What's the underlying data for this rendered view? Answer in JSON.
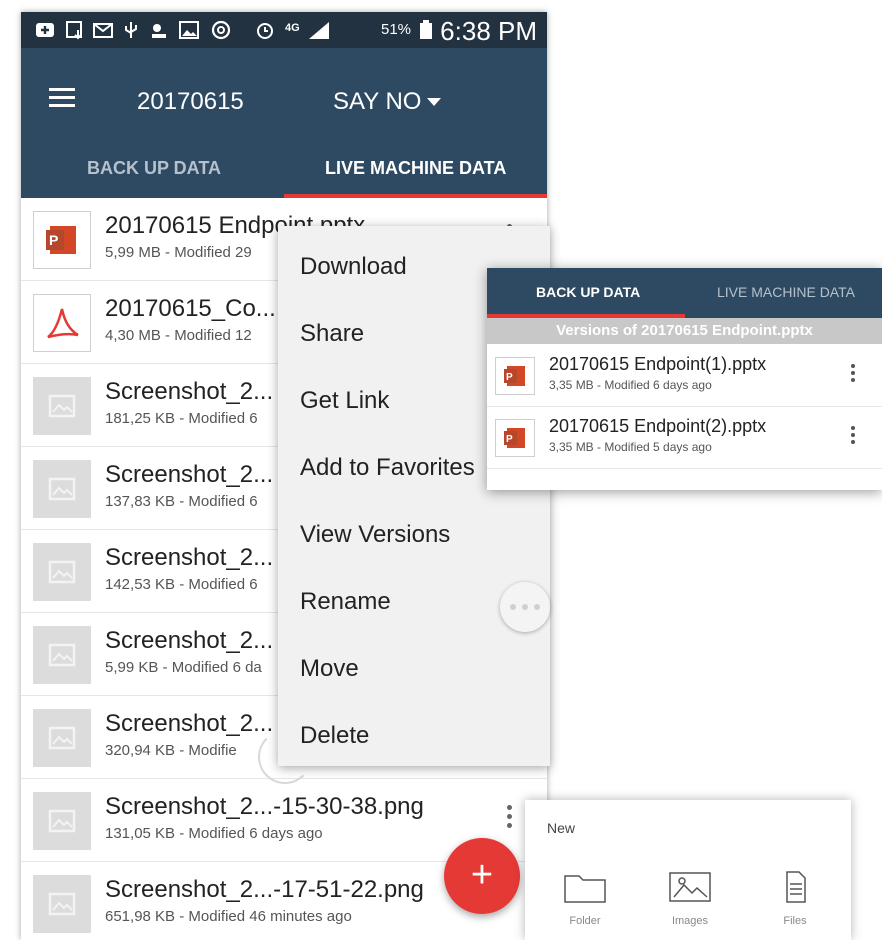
{
  "status_bar": {
    "battery": "51%",
    "time": "6:38 PM",
    "network": "4G"
  },
  "app_bar": {
    "title": "20170615",
    "dropdown": "SAY NO"
  },
  "tabs": [
    {
      "label": "BACK UP DATA"
    },
    {
      "label": "LIVE MACHINE DATA"
    }
  ],
  "files": [
    {
      "name": "20170615 Endpoint.pptx",
      "meta": "5,99 MB - Modified 29",
      "type": "pptx"
    },
    {
      "name": "20170615_Co...",
      "meta": "4,30 MB - Modified 12",
      "type": "pdf"
    },
    {
      "name": "Screenshot_2...",
      "meta": "181,25 KB - Modified 6",
      "type": "image"
    },
    {
      "name": "Screenshot_2...",
      "meta": "137,83 KB - Modified 6",
      "type": "image"
    },
    {
      "name": "Screenshot_2...",
      "meta": "142,53 KB - Modified 6",
      "type": "image"
    },
    {
      "name": "Screenshot_2...",
      "meta": "5,99 KB - Modified 6 da",
      "type": "image"
    },
    {
      "name": "Screenshot_2...",
      "meta": "320,94 KB - Modifie",
      "type": "image"
    },
    {
      "name": "Screenshot_2...-15-30-38.png",
      "meta": "131,05 KB - Modified 6 days ago",
      "type": "image"
    },
    {
      "name": "Screenshot_2...-17-51-22.png",
      "meta": "651,98 KB - Modified 46 minutes ago",
      "type": "image"
    }
  ],
  "context_menu": [
    "Download",
    "Share",
    "Get Link",
    "Add to Favorites",
    "View Versions",
    "Rename",
    "Move",
    "Delete"
  ],
  "versions_panel": {
    "tabs": [
      "BACK UP DATA",
      "LIVE MACHINE DATA"
    ],
    "header": "Versions of 20170615 Endpoint.pptx",
    "items": [
      {
        "name": "20170615 Endpoint(1).pptx",
        "meta": "3,35 MB - Modified 6 days ago"
      },
      {
        "name": "20170615 Endpoint(2).pptx",
        "meta": "3,35 MB - Modified 5 days ago"
      }
    ]
  },
  "new_card": {
    "title": "New",
    "items": [
      "Folder",
      "Images",
      "Files"
    ]
  },
  "fab_label": "+",
  "colors": {
    "app_bar": "#2e4a62",
    "status_bar": "#233240",
    "accent": "#e53935"
  }
}
